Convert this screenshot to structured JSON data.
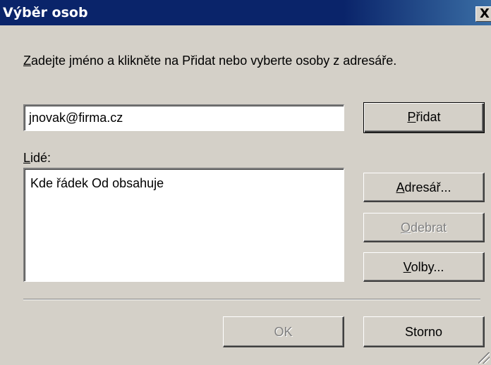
{
  "window": {
    "title": "Výběr osob",
    "close_symbol": "X"
  },
  "instruction": {
    "mnemonic": "Z",
    "rest": "adejte jméno a klikněte na Přidat nebo vyberte osoby z adresáře."
  },
  "name_input": {
    "value": "jnovak@firma.cz"
  },
  "buttons": {
    "add": {
      "mnemonic": "P",
      "rest": "řidat"
    },
    "address_book": {
      "mnemonic": "A",
      "rest": "dresář..."
    },
    "remove": {
      "mnemonic": "O",
      "rest": "debrat",
      "enabled": false
    },
    "options": {
      "mnemonic": "V",
      "rest": "olby..."
    },
    "ok": {
      "label": "OK",
      "enabled": false
    },
    "cancel": {
      "label": "Storno"
    }
  },
  "people": {
    "label_mnemonic": "L",
    "label_rest": "idé:",
    "items": [
      "Kde řádek Od obsahuje"
    ]
  },
  "colors": {
    "titlebar": "#0a246a",
    "face": "#d4d0c8",
    "disabled_text": "#808080"
  }
}
